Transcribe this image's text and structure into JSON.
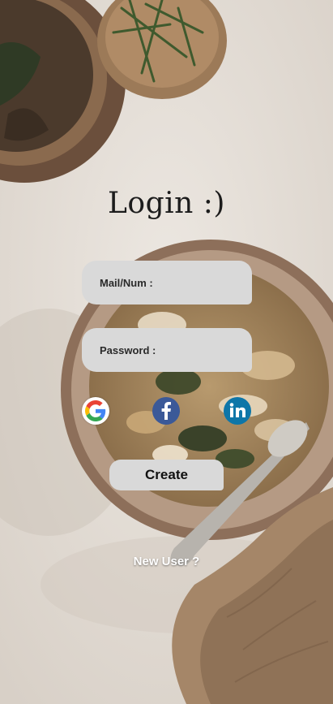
{
  "title": "Login :)",
  "form": {
    "mail_label": "Mail/Num :",
    "mail_value": "",
    "password_label": "Password :",
    "password_value": ""
  },
  "social": [
    {
      "name": "Google",
      "icon": "google-icon",
      "glyph": "G"
    },
    {
      "name": "Facebook",
      "icon": "facebook-icon",
      "glyph": "f"
    },
    {
      "name": "LinkedIn",
      "icon": "linkedin-icon",
      "glyph": "in"
    }
  ],
  "create_label": "Create",
  "new_user_label": "New User ?",
  "colors": {
    "field_bg": "#d9d9d9",
    "title": "#1c1c1c",
    "facebook": "#3b5998",
    "linkedin": "#0e76a8",
    "backdrop": "#e6e0d9"
  }
}
